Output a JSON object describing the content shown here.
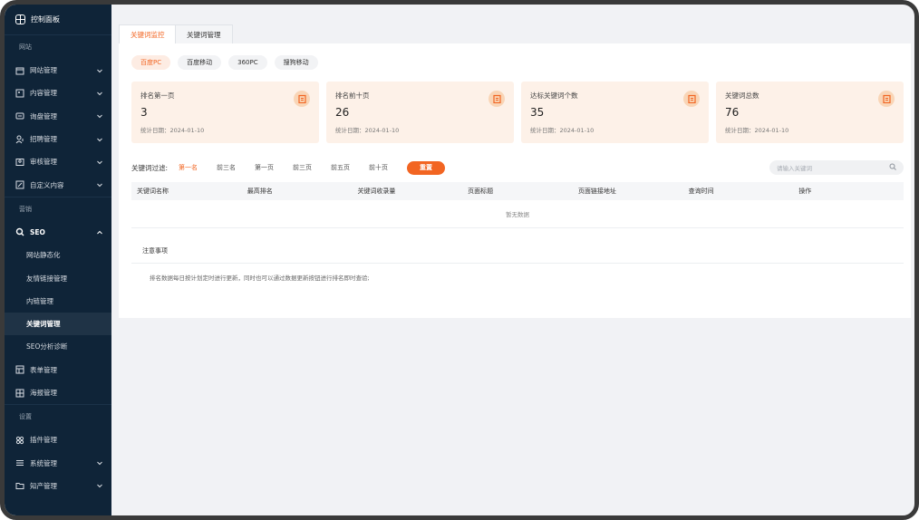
{
  "sidebar": {
    "brand": "控制面板",
    "groups": {
      "site": "网站",
      "marketing": "营销",
      "settings": "设置"
    },
    "items": {
      "site_mgmt": "网站管理",
      "content_mgmt": "内容管理",
      "inquiry_mgmt": "询盘管理",
      "recruit_mgmt": "招聘管理",
      "review_mgmt": "审核管理",
      "custom_content": "自定义内容",
      "seo": "SEO",
      "seo_static": "网站静态化",
      "seo_links": "友情链接管理",
      "seo_internal": "内链管理",
      "seo_keywords": "关键词管理",
      "seo_analysis": "SEO分析诊断",
      "form_mgmt": "表单管理",
      "poster_mgmt": "海报管理",
      "plugin_mgmt": "插件管理",
      "system_mgmt": "系统管理",
      "ip_mgmt": "知产管理"
    }
  },
  "tabs": [
    "关键词监控",
    "关键词管理"
  ],
  "chips": [
    "百度PC",
    "百度移动",
    "360PC",
    "搜狗移动"
  ],
  "cards": [
    {
      "title": "排名第一页",
      "value": "3",
      "date": "统计日期：2024-01-10"
    },
    {
      "title": "排名前十页",
      "value": "26",
      "date": "统计日期：2024-01-10"
    },
    {
      "title": "达标关键词个数",
      "value": "35",
      "date": "统计日期：2024-01-10"
    },
    {
      "title": "关键词总数",
      "value": "76",
      "date": "统计日期：2024-01-10"
    }
  ],
  "filter": {
    "label": "关键词过滤:",
    "options": [
      "第一名",
      "前三名",
      "第一页",
      "前三页",
      "前五页",
      "前十页"
    ],
    "reset": "重置",
    "search_placeholder": "请输入关键词"
  },
  "table": {
    "headers": [
      "关键词名称",
      "最高排名",
      "关键词收录量",
      "页面标题",
      "页面链接地址",
      "查询时间",
      "操作"
    ],
    "empty": "暂无数据"
  },
  "notes": {
    "title": "注意事项",
    "body": "排名数据每日按计划定时进行更新，同时也可以通过数据更新按钮进行排名即时查验;"
  },
  "colors": {
    "accent": "#f26522",
    "sidebar": "#0f2438",
    "card": "#fdf1e8"
  }
}
